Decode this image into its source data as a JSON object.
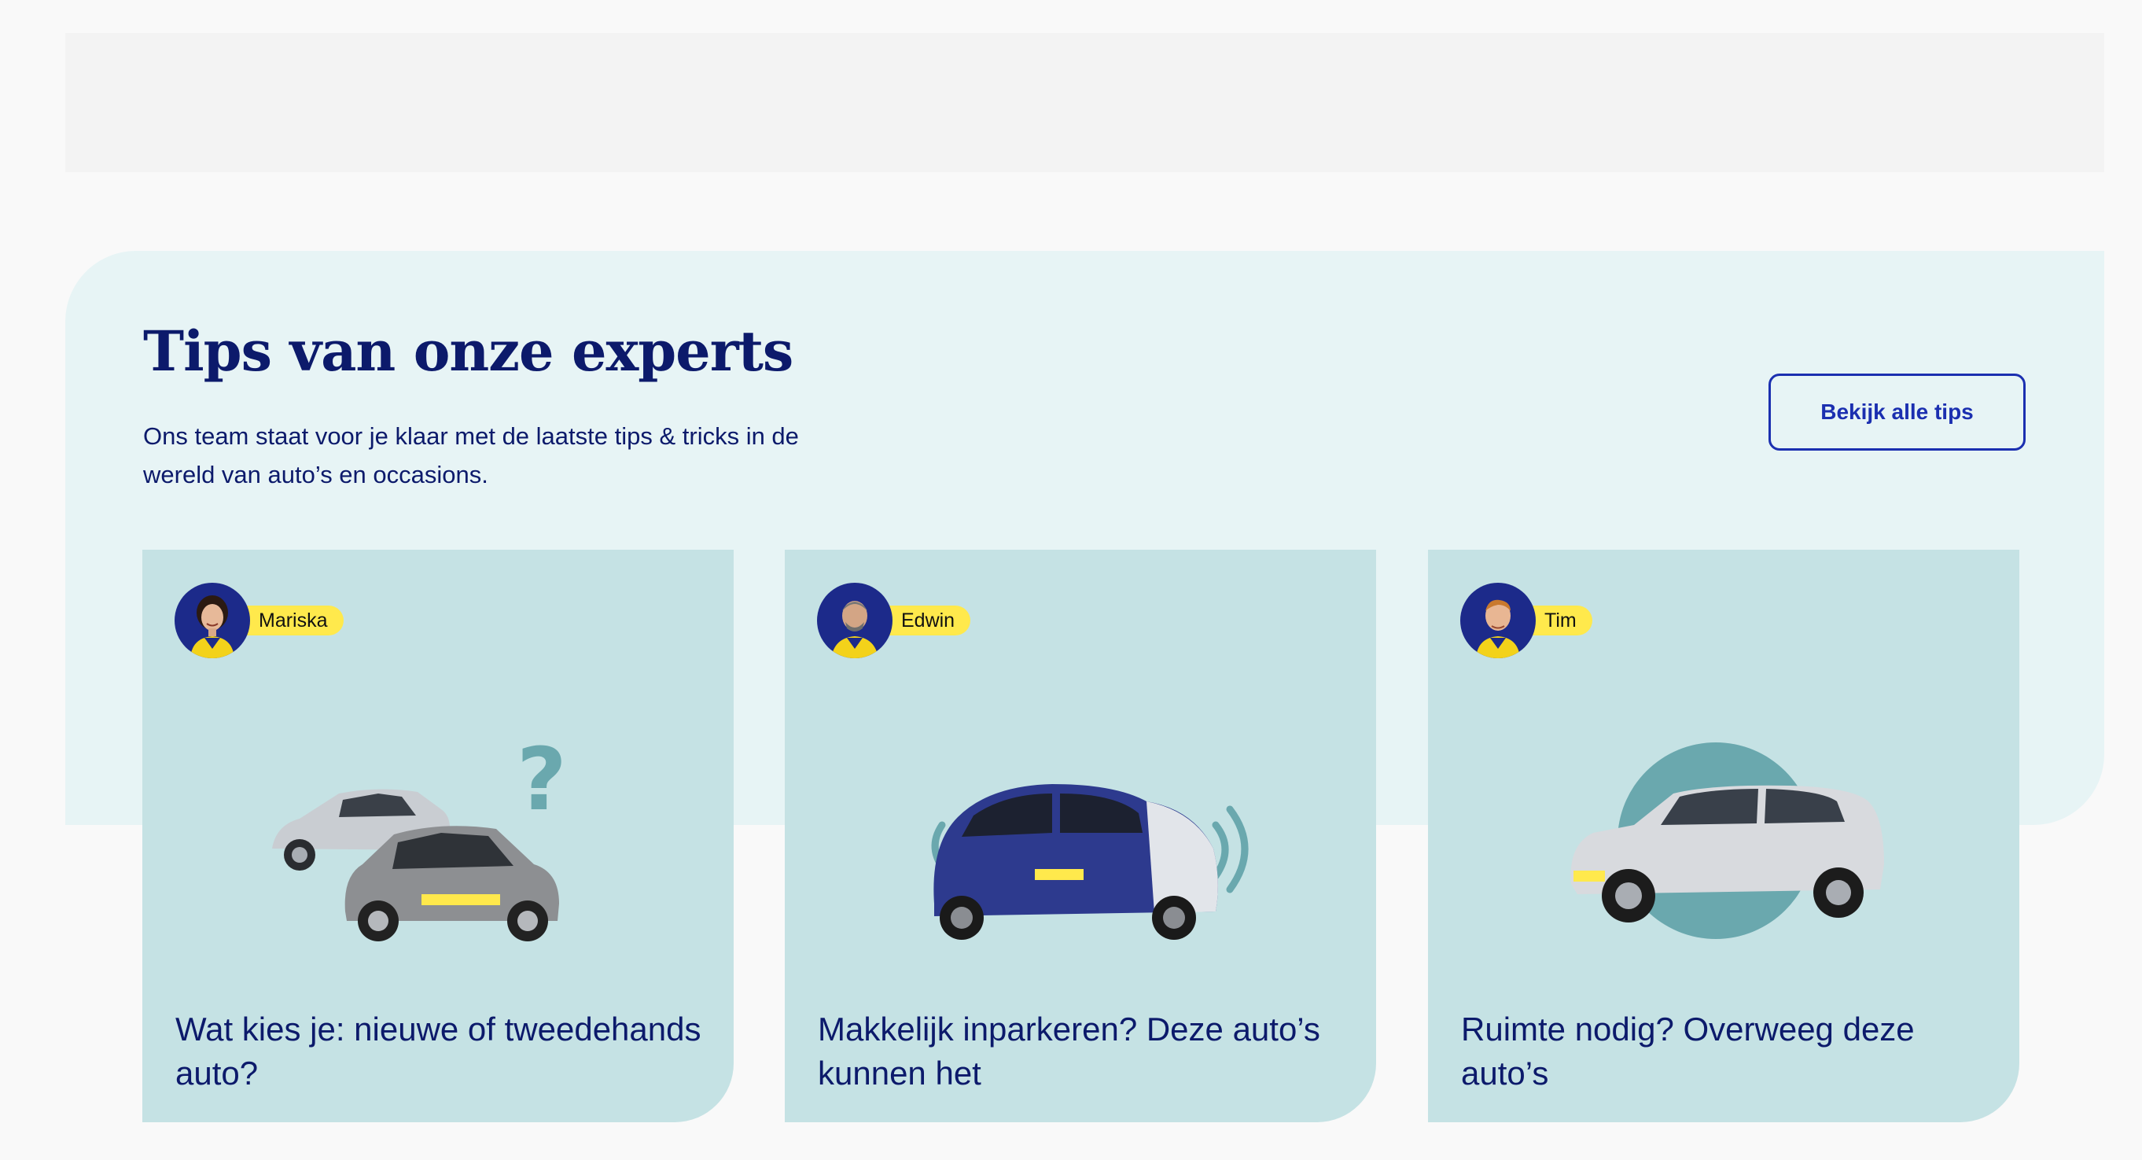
{
  "section": {
    "title": "Tips van onze experts",
    "subtitle": "Ons team staat voor je klaar met de laatste tips & tricks in de wereld van auto’s en occasions.",
    "all_tips_label": "Bekijk alle tips"
  },
  "colors": {
    "navy": "#0c1a6b",
    "button_blue": "#1b2fb0",
    "panel_bg": "#e7f4f5",
    "card_bg": "#c5e2e4",
    "name_tag": "#ffe94c",
    "avatar_bg": "#1c2a8a",
    "accent_teal": "#6aa8ae"
  },
  "cards": [
    {
      "author": "Mariska",
      "title": "Wat kies je: nieuwe of tweedehands auto?",
      "illustration": "two-cars-question-mark"
    },
    {
      "author": "Edwin",
      "title": "Makkelijk inparkeren? Deze auto’s kunnen het",
      "illustration": "small-city-car-with-sensor-waves"
    },
    {
      "author": "Tim",
      "title": "Ruimte nodig? Overweeg deze auto’s",
      "illustration": "suv-with-teal-circle"
    }
  ]
}
